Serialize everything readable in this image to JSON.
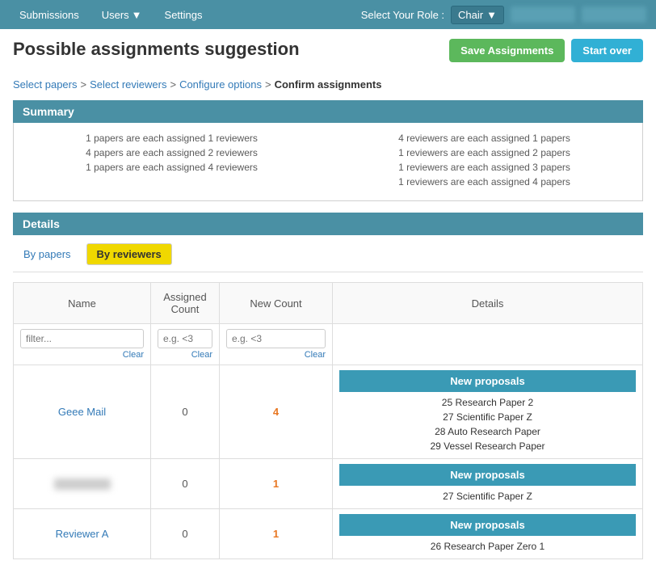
{
  "navbar": {
    "items": [
      {
        "label": "Submissions",
        "dropdown": false
      },
      {
        "label": "Users",
        "dropdown": true
      },
      {
        "label": "Settings",
        "dropdown": false
      }
    ],
    "role_label": "Select Your Role :",
    "role": "Chair",
    "user1_placeholder": "user1",
    "user2_placeholder": "user2"
  },
  "page": {
    "title": "Possible assignments suggestion",
    "breadcrumb": [
      {
        "label": "Select papers",
        "link": true
      },
      {
        "label": "Select reviewers",
        "link": true
      },
      {
        "label": "Configure options",
        "link": true
      },
      {
        "label": "Confirm assignments",
        "link": false
      }
    ],
    "separator": ">",
    "save_button": "Save Assignments",
    "start_over_button": "Start over"
  },
  "summary": {
    "header": "Summary",
    "left_items": [
      "1 papers are each assigned 1 reviewers",
      "4 papers are each assigned 2 reviewers",
      "1 papers are each assigned 4 reviewers"
    ],
    "right_items": [
      "4 reviewers are each assigned 1 papers",
      "1 reviewers are each assigned 2 papers",
      "1 reviewers are each assigned 3 papers",
      "1 reviewers are each assigned 4 papers"
    ]
  },
  "details": {
    "header": "Details",
    "tabs": [
      {
        "label": "By papers",
        "active": false
      },
      {
        "label": "By reviewers",
        "active": true
      }
    ],
    "table": {
      "columns": [
        "Name",
        "Assigned Count",
        "New Count",
        "Details"
      ],
      "filter_name_placeholder": "filter...",
      "filter_assigned_placeholder": "e.g. <3",
      "filter_new_placeholder": "e.g. <3",
      "clear_label": "Clear",
      "rows": [
        {
          "name": "Geee Mail",
          "assigned_count": "0",
          "new_count": "4",
          "proposals_header": "New proposals",
          "proposals": [
            "25 Research Paper 2",
            "27 Scientific Paper Z",
            "28 Auto Research Paper",
            "29 Vessel Research Paper"
          ]
        },
        {
          "name": "blurred",
          "assigned_count": "0",
          "new_count": "1",
          "proposals_header": "New proposals",
          "proposals": [
            "27 Scientific Paper Z"
          ]
        },
        {
          "name": "Reviewer A",
          "assigned_count": "0",
          "new_count": "1",
          "proposals_header": "New proposals",
          "proposals": [
            "26 Research Paper Zero 1"
          ]
        }
      ]
    }
  }
}
